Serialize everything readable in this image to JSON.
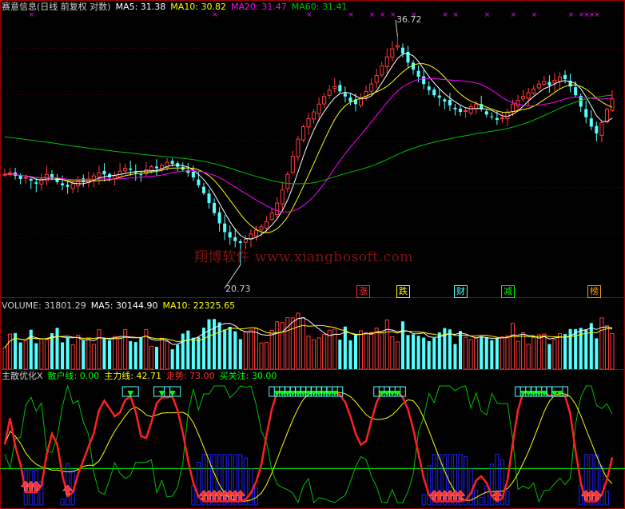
{
  "colors": {
    "up": "#ff3b3b",
    "down": "#55ffff",
    "ma5": "#ffffff",
    "ma10": "#ffff00",
    "ma20": "#ff00ff",
    "ma60": "#00c000",
    "frame": "#a00000",
    "grid": "#5a0000"
  },
  "header": {
    "title": "赛意信息(日线 前复权 对数)",
    "ma5": "MA5: 31.38",
    "ma10": "MA10: 30.82",
    "ma20": "MA20: 31.47",
    "ma60": "MA60: 31.41"
  },
  "watermark": "翔博软件 www.xiangbosoft.com",
  "price_panel": {
    "high_label": "36.72",
    "low_label": "20.73",
    "events": [
      {
        "label": "涨",
        "color": "#ff3030"
      },
      {
        "label": "跌",
        "color": "#ffff00"
      },
      {
        "label": "财",
        "color": "#55ffff"
      },
      {
        "label": "减",
        "color": "#00ff00"
      },
      {
        "label": "榜",
        "color": "#ffa000"
      }
    ]
  },
  "volume_header": {
    "volume": "VOLUME: 31801.29",
    "ma5": "MA5: 30144.90",
    "ma10": "MA10: 22325.65"
  },
  "indicator_header": {
    "name": "主散优化X",
    "retail": "散户线: 0.00",
    "main": "主力线: 42.71",
    "trend": "走势: 73.00",
    "attention": "买关注: 30.00"
  },
  "chart_data": [
    {
      "type": "candlestick",
      "title": "赛意信息(日线 前复权 对数)",
      "scale": "log",
      "ylim": [
        19.5,
        38.5
      ],
      "series": [
        {
          "name": "MA5",
          "last": 31.38
        },
        {
          "name": "MA10",
          "last": 30.82
        },
        {
          "name": "MA20",
          "last": 31.47
        },
        {
          "name": "MA60",
          "last": 31.41
        }
      ],
      "closes": [
        26.0,
        26.1,
        25.9,
        25.7,
        25.8,
        25.6,
        25.4,
        25.7,
        26.0,
        25.8,
        25.5,
        25.3,
        25.2,
        25.4,
        25.6,
        25.5,
        25.7,
        25.9,
        26.1,
        26.0,
        25.8,
        25.9,
        26.2,
        26.4,
        26.3,
        26.1,
        26.0,
        26.3,
        26.5,
        26.4,
        26.6,
        26.8,
        26.7,
        26.5,
        26.3,
        26.1,
        25.8,
        25.3,
        24.8,
        24.2,
        23.6,
        23.0,
        22.5,
        22.2,
        22.0,
        21.9,
        22.1,
        22.4,
        22.6,
        22.8,
        23.1,
        23.6,
        24.2,
        25.0,
        26.0,
        27.2,
        28.4,
        29.3,
        29.9,
        30.4,
        31.0,
        31.6,
        32.1,
        32.4,
        32.0,
        31.6,
        31.2,
        31.0,
        31.4,
        32.0,
        32.6,
        33.3,
        34.1,
        34.9,
        35.6,
        35.9,
        35.2,
        34.4,
        33.8,
        33.2,
        32.6,
        32.1,
        31.7,
        31.5,
        31.2,
        30.9,
        30.6,
        30.4,
        30.5,
        30.8,
        31.0,
        30.6,
        30.2,
        30.0,
        29.8,
        29.9,
        30.4,
        31.0,
        31.3,
        31.6,
        31.9,
        32.2,
        32.6,
        32.8,
        32.5,
        32.9,
        33.2,
        33.0,
        32.4,
        31.7,
        30.8,
        30.0,
        29.3,
        28.8,
        29.6,
        30.6,
        31.4
      ],
      "high": 36.72,
      "low": 20.73
    },
    {
      "type": "bar",
      "title": "VOLUME",
      "series": [
        {
          "name": "VOLUME",
          "last": 31801.29
        },
        {
          "name": "MA5",
          "last": 30144.9
        },
        {
          "name": "MA10",
          "last": 22325.65
        }
      ]
    },
    {
      "type": "line",
      "title": "主散优化X",
      "ylim": [
        0,
        100
      ],
      "series": [
        {
          "name": "散户线",
          "last": 0.0
        },
        {
          "name": "主力线",
          "last": 42.71
        },
        {
          "name": "走势",
          "last": 73.0
        },
        {
          "name": "买关注",
          "last": 30.0
        }
      ]
    }
  ]
}
